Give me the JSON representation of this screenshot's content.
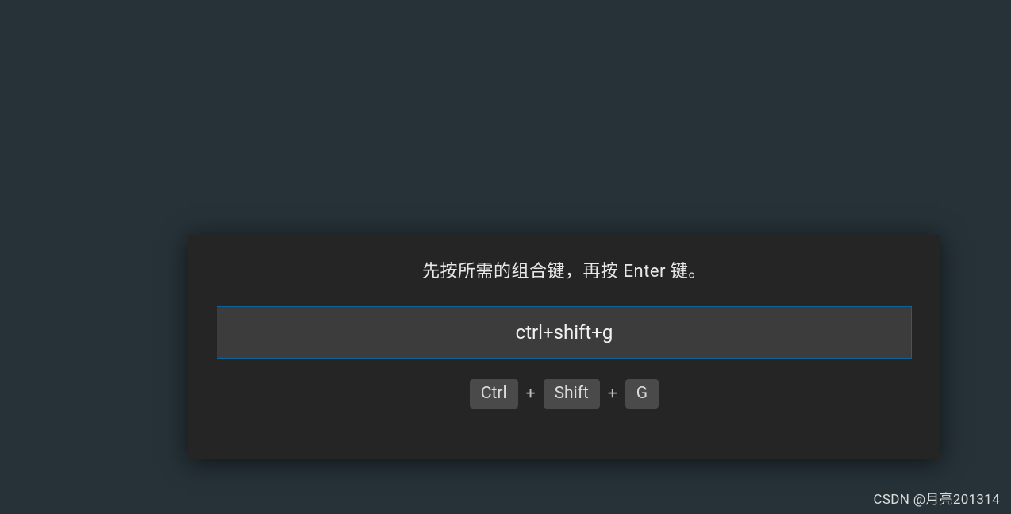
{
  "dialog": {
    "instruction": "先按所需的组合键，再按 Enter 键。",
    "input_value": "ctrl+shift+g",
    "keys": {
      "k1": "Ctrl",
      "sep1": "+",
      "k2": "Shift",
      "sep2": "+",
      "k3": "G"
    }
  },
  "watermark": "CSDN @月亮201314"
}
